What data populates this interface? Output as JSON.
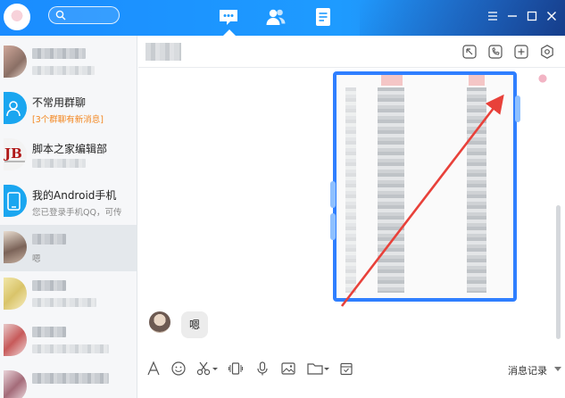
{
  "colors": {
    "topbar": "#1e9bff",
    "accent": "#2f7fff",
    "annotation_arrow": "#e8413a",
    "unread_notice": "#f3861f"
  },
  "topbar": {
    "icons": [
      "avatar",
      "search-icon",
      "message-tab-icon",
      "contacts-tab-icon",
      "space-tab-icon",
      "menu-icon",
      "minimize-icon",
      "maximize-icon",
      "close-icon"
    ]
  },
  "sidebar": {
    "items": [
      {
        "title": "",
        "subtitle": "",
        "blurred": true
      },
      {
        "title": "不常用群聊",
        "subtitle": "[3个群聊有新消息]",
        "icon": "group-icon"
      },
      {
        "title": "脚本之家编辑部",
        "subtitle": "",
        "icon": "group-avatar"
      },
      {
        "title": "我的Android手机",
        "subtitle": "您已登录手机QQ，可传",
        "icon": "phone-icon"
      },
      {
        "title": "",
        "subtitle": "嗯",
        "blurred": true,
        "selected": true
      },
      {
        "title": "",
        "subtitle": "",
        "blurred": true
      },
      {
        "title": "",
        "subtitle": "",
        "blurred": true
      },
      {
        "title": "",
        "subtitle": "",
        "blurred": true
      }
    ]
  },
  "chat": {
    "header_icons": [
      "screen-share-icon",
      "voice-call-icon",
      "add-member-icon",
      "settings-icon"
    ],
    "messages": [
      {
        "type": "image",
        "sender": "self"
      },
      {
        "type": "text",
        "sender": "other",
        "text": "嗯"
      }
    ]
  },
  "toolbar": {
    "icons": [
      "font-icon",
      "emoji-icon",
      "screenshot-icon",
      "shake-icon",
      "voice-icon",
      "picture-icon",
      "file-icon",
      "calendar-icon"
    ],
    "history_label": "消息记录"
  }
}
